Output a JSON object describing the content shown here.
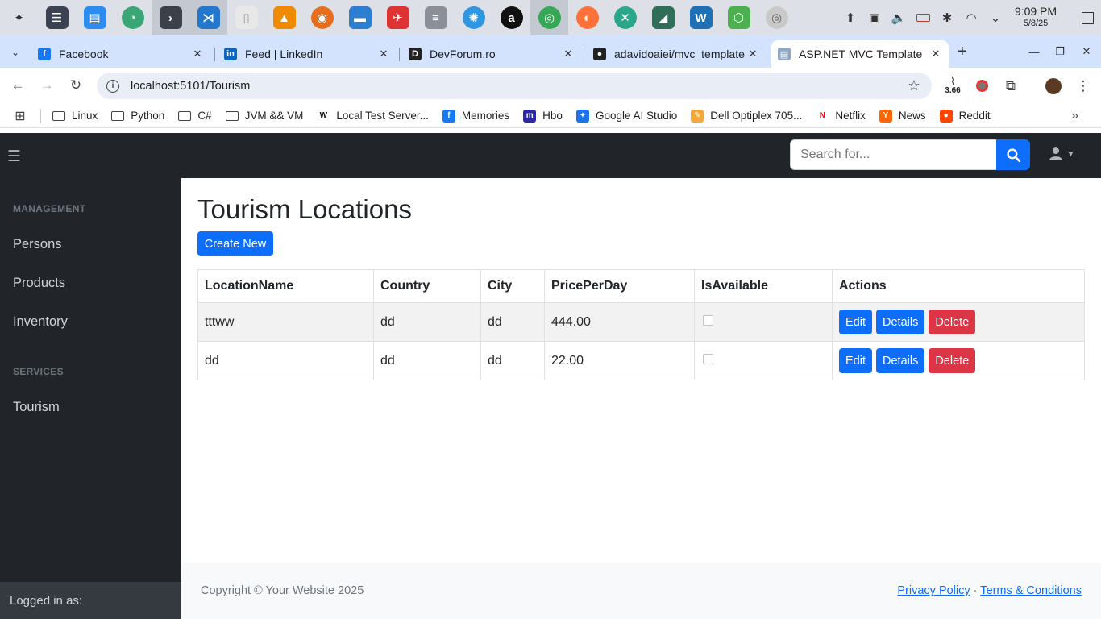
{
  "taskbar": {
    "apps": [
      {
        "icon": "app-launcher-icon",
        "color": "#dde0e6",
        "glyph": "✦",
        "fg": "#333"
      },
      {
        "icon": "settings-manager-icon",
        "color": "#3b4252",
        "glyph": "☰",
        "fg": "#fff"
      },
      {
        "icon": "software-store-icon",
        "color": "#2d8cf0",
        "glyph": "▤",
        "fg": "#fff"
      },
      {
        "icon": "timeshift-icon",
        "color": "#3aa675",
        "glyph": "◔",
        "fg": "#fff"
      },
      {
        "icon": "terminal-icon",
        "color": "#3c4048",
        "glyph": "›",
        "fg": "#fff"
      },
      {
        "icon": "vscode-icon",
        "color": "#2478cc",
        "glyph": "⋊",
        "fg": "#fff"
      },
      {
        "icon": "text-editor-icon",
        "color": "#e8e8e8",
        "glyph": "▯",
        "fg": "#999"
      },
      {
        "icon": "vlc-icon",
        "color": "#f08a00",
        "glyph": "▲",
        "fg": "#fff"
      },
      {
        "icon": "fish-app-icon",
        "color": "#e66d1c",
        "glyph": "◉",
        "fg": "#fff"
      },
      {
        "icon": "file-manager-icon",
        "color": "#2d7ed1",
        "glyph": "▬",
        "fg": "#fff"
      },
      {
        "icon": "racing-game-icon",
        "color": "#d33",
        "glyph": "✈",
        "fg": "#fff"
      },
      {
        "icon": "database-icon",
        "color": "#8a8f98",
        "glyph": "≡",
        "fg": "#fff"
      },
      {
        "icon": "web-browser-icon",
        "color": "#3196e2",
        "glyph": "✺",
        "fg": "#fff"
      },
      {
        "icon": "a-app-icon",
        "color": "#111",
        "glyph": "a",
        "fg": "#fff"
      },
      {
        "icon": "chrome-icon",
        "color": "#34a853",
        "glyph": "◎",
        "fg": "#fff"
      },
      {
        "icon": "firefox-icon",
        "color": "#ff7139",
        "glyph": "◐",
        "fg": "#fff"
      },
      {
        "icon": "xdebug-icon",
        "color": "#2aa68b",
        "glyph": "✕",
        "fg": "#fff"
      },
      {
        "icon": "system-monitor-icon",
        "color": "#2f6f5a",
        "glyph": "◢",
        "fg": "#fff"
      },
      {
        "icon": "vmware-icon",
        "color": "#1f6fb5",
        "glyph": "W",
        "fg": "#fff"
      },
      {
        "icon": "cube-app-icon",
        "color": "#4caf50",
        "glyph": "⬡",
        "fg": "#fff"
      },
      {
        "icon": "disc-icon",
        "color": "#c9c9c9",
        "glyph": "◎",
        "fg": "#666"
      }
    ],
    "active_app_index": 14,
    "highlighted_app_indexes": [
      4,
      5
    ],
    "clock_time": "9:09 PM",
    "clock_date": "5/8/25"
  },
  "browser": {
    "tabs": [
      {
        "label": "Facebook",
        "favicon": "facebook-icon",
        "color": "#1877f2",
        "glyph": "f"
      },
      {
        "label": "Feed | LinkedIn",
        "favicon": "linkedin-icon",
        "color": "#0a66c2",
        "glyph": "in"
      },
      {
        "label": "DevForum.ro",
        "favicon": "devforum-icon",
        "color": "#222",
        "glyph": "D"
      },
      {
        "label": "adavidoaiei/mvc_template",
        "favicon": "github-icon",
        "color": "#222",
        "glyph": "●"
      },
      {
        "label": "ASP.NET MVC Template",
        "favicon": "page-icon",
        "color": "#8fa6c4",
        "glyph": "▤"
      }
    ],
    "active_tab_index": 4,
    "url_host": "localhost",
    "url_path": ":5101/Tourism",
    "extension_badge": "3.66"
  },
  "bookmarks": [
    {
      "label": "Linux",
      "type": "folder"
    },
    {
      "label": "Python",
      "type": "folder"
    },
    {
      "label": "C#",
      "type": "folder"
    },
    {
      "label": "JVM && VM",
      "type": "folder"
    },
    {
      "label": "Local Test Server...",
      "type": "site",
      "icon": "local-server-icon",
      "color": "#fff",
      "fg": "#111",
      "glyph": "W"
    },
    {
      "label": "Memories",
      "type": "site",
      "icon": "facebook-icon",
      "color": "#1877f2",
      "fg": "#fff",
      "glyph": "f"
    },
    {
      "label": "Hbo",
      "type": "site",
      "icon": "hbo-icon",
      "color": "#2a2aa8",
      "fg": "#fff",
      "glyph": "m"
    },
    {
      "label": "Google AI Studio",
      "type": "site",
      "icon": "ai-studio-icon",
      "color": "#1a73e8",
      "fg": "#fff",
      "glyph": "✦"
    },
    {
      "label": "Dell Optiplex 705...",
      "type": "site",
      "icon": "dell-icon",
      "color": "#f2a83b",
      "fg": "#fff",
      "glyph": "✎"
    },
    {
      "label": "Netflix",
      "type": "site",
      "icon": "netflix-icon",
      "color": "#fff",
      "fg": "#e50914",
      "glyph": "N"
    },
    {
      "label": "News",
      "type": "site",
      "icon": "hacker-news-icon",
      "color": "#ff6600",
      "fg": "#fff",
      "glyph": "Y"
    },
    {
      "label": "Reddit",
      "type": "site",
      "icon": "reddit-icon",
      "color": "#ff4500",
      "fg": "#fff",
      "glyph": "●"
    }
  ],
  "app": {
    "search_placeholder": "Search for...",
    "sidebar": {
      "sections": [
        {
          "heading": "MANAGEMENT",
          "items": [
            "Persons",
            "Products",
            "Inventory"
          ]
        },
        {
          "heading": "SERVICES",
          "items": [
            "Tourism"
          ]
        }
      ],
      "footer": "Logged in as:"
    },
    "page_title": "Tourism Locations",
    "create_label": "Create New",
    "table": {
      "columns": [
        "LocationName",
        "Country",
        "City",
        "PricePerDay",
        "IsAvailable",
        "Actions"
      ],
      "rows": [
        {
          "LocationName": "tttww",
          "Country": "dd",
          "City": "dd",
          "PricePerDay": "444.00",
          "IsAvailable": false
        },
        {
          "LocationName": "dd",
          "Country": "dd",
          "City": "dd",
          "PricePerDay": "22.00",
          "IsAvailable": false
        }
      ],
      "actions": [
        "Edit",
        "Details",
        "Delete"
      ]
    },
    "footer": {
      "copyright": "Copyright © Your Website 2025",
      "privacy": "Privacy Policy",
      "separator": "·",
      "terms": "Terms & Conditions"
    },
    "colors": {
      "primary": "#0d6efd",
      "danger": "#dc3545",
      "sidebar": "#212529"
    }
  }
}
